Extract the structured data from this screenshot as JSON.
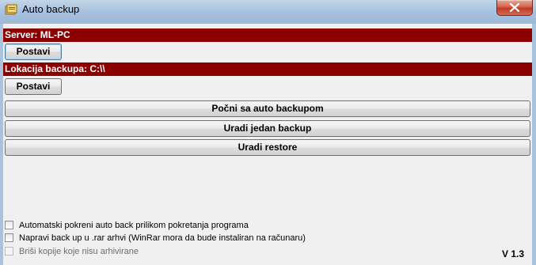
{
  "window": {
    "title": "Auto backup"
  },
  "server": {
    "label": "Server: ML-PC",
    "button_label": "Postavi"
  },
  "location": {
    "label": "Lokacija backupa: C:\\\\",
    "button_label": "Postavi"
  },
  "actions": {
    "start_auto": "Počni sa auto backupom",
    "single_backup": "Uradi jedan backup",
    "restore": "Uradi restore"
  },
  "options": {
    "autostart": "Automatski pokreni auto back prilikom pokretanja programa",
    "rar_backup": "Napravi back up u .rar arhvi  (WinRar mora da bude instaliran na računaru)",
    "delete_copies": "Briši kopije koje nisu arhivirane"
  },
  "version": "V 1.3",
  "colors": {
    "header_bar": "#8b0000",
    "titlebar": "#a9c3de",
    "close_button": "#c0392b"
  }
}
